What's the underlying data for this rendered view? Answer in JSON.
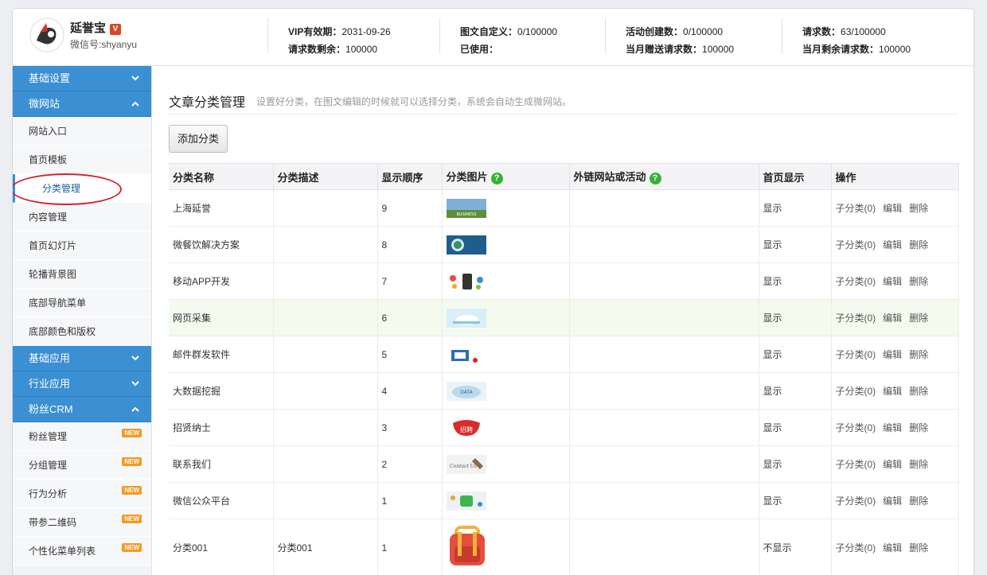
{
  "header": {
    "brand_name": "延誉宝",
    "brand_badge": "V",
    "wechat_id": "微信号:shyanyu",
    "stats": [
      {
        "label": "VIP有效期：",
        "value": "2031-09-26"
      },
      {
        "label": "请求数剩余：",
        "value": "100000"
      },
      {
        "label": "图文自定义：",
        "value": "0/100000"
      },
      {
        "label": "已使用：",
        "value": ""
      },
      {
        "label": "活动创建数：",
        "value": "0/100000"
      },
      {
        "label": "当月赠送请求数：",
        "value": "100000"
      },
      {
        "label": "请求数：",
        "value": "63/100000"
      },
      {
        "label": "当月剩余请求数：",
        "value": "100000"
      }
    ]
  },
  "sidebar": {
    "groups": [
      {
        "label": "基础设置",
        "icon": "chevron-down-icon"
      },
      {
        "label": "微网站",
        "icon": "chevron-up-icon"
      },
      {
        "label": "基础应用",
        "icon": "chevron-down-icon"
      },
      {
        "label": "行业应用",
        "icon": "chevron-down-icon"
      },
      {
        "label": "粉丝CRM",
        "icon": "chevron-up-icon"
      }
    ],
    "site_items": [
      "网站入口",
      "首页模板",
      "分类管理",
      "内容管理",
      "首页幻灯片",
      "轮播背景图",
      "底部导航菜单",
      "底部颜色和版权"
    ],
    "crm_items": [
      "粉丝管理",
      "分组管理",
      "行为分析",
      "带参二维码",
      "个性化菜单列表"
    ],
    "new_badge": "NEW"
  },
  "main": {
    "title": "文章分类管理",
    "subtitle": "设置好分类，在图文编辑的时候就可以选择分类，系统会自动生成微网站。",
    "add_button": "添加分类",
    "columns": [
      "分类名称",
      "分类描述",
      "显示顺序",
      "分类图片",
      "外链网站或活动",
      "首页显示",
      "操作"
    ],
    "help_icon": "?",
    "rows": [
      {
        "name": "上海延誉",
        "desc": "",
        "order": "9",
        "image": "business-thumbnail",
        "link": "",
        "show": "显示"
      },
      {
        "name": "微餐饮解决方案",
        "desc": "",
        "order": "8",
        "image": "globe-thumbnail",
        "link": "",
        "show": "显示"
      },
      {
        "name": "移动APP开发",
        "desc": "",
        "order": "7",
        "image": "app-icons-thumbnail",
        "link": "",
        "show": "显示"
      },
      {
        "name": "网页采集",
        "desc": "",
        "order": "6",
        "image": "hand-web-thumbnail",
        "link": "",
        "show": "显示"
      },
      {
        "name": "邮件群发软件",
        "desc": "",
        "order": "5",
        "image": "email-thumbnail",
        "link": "",
        "show": "显示"
      },
      {
        "name": "大数据挖掘",
        "desc": "",
        "order": "4",
        "image": "big-data-thumbnail",
        "link": "",
        "show": "显示"
      },
      {
        "name": "招贤纳士",
        "desc": "",
        "order": "3",
        "image": "recruit-thumbnail",
        "link": "",
        "show": "显示"
      },
      {
        "name": "联系我们",
        "desc": "",
        "order": "2",
        "image": "contact-thumbnail",
        "link": "",
        "show": "显示"
      },
      {
        "name": "微信公众平台",
        "desc": "",
        "order": "1",
        "image": "wechat-thumbnail",
        "link": "",
        "show": "显示"
      },
      {
        "name": "分类001",
        "desc": "分类001",
        "order": "1",
        "image": "backpack-thumbnail",
        "link": "",
        "show": "不显示"
      }
    ],
    "ops": {
      "sub": "子分类(0)",
      "edit": "编辑",
      "delete": "删除"
    }
  },
  "colors": {
    "accent": "#3b8fd3",
    "help": "#35b236",
    "annotation": "#d6232a",
    "hover_row": "#f4fbee"
  }
}
